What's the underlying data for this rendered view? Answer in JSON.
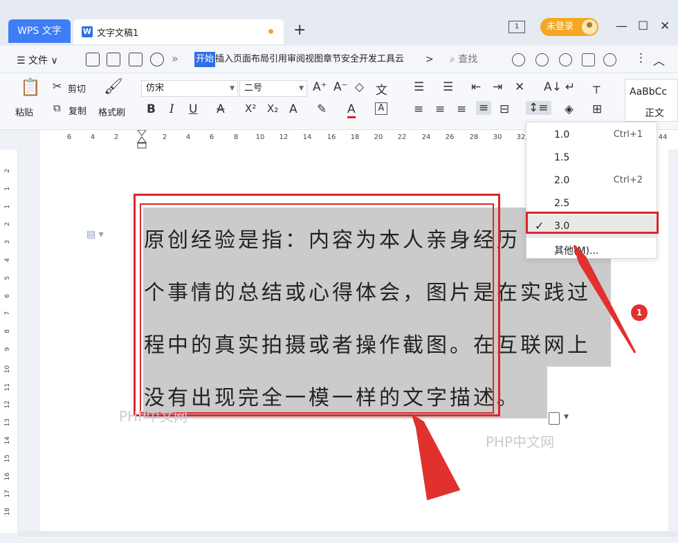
{
  "titlebar": {
    "app_tab": "WPS 文字",
    "doc_tab": "文字文稿1",
    "doc_icon": "W",
    "new_tab": "+",
    "window_icon": "1",
    "login": "未登录",
    "min": "—",
    "max": "☐",
    "close": "✕"
  },
  "menubar": {
    "file": "☰ 文件 ∨",
    "more": "»",
    "active_tab": "开始",
    "tabs": "插入页面布局引用审阅视图章节安全开发工具云",
    "tab_more": ">",
    "search": "⌕ 查找"
  },
  "ribbon": {
    "paste": "粘贴",
    "cut": "剪切",
    "copy": "复制",
    "format_painter": "格式刷",
    "font": "仿宋",
    "size": "二号",
    "style_preview": "AaBbCc",
    "style_name": "正文",
    "bold": "B",
    "italic": "I",
    "underline": "U",
    "super": "X²",
    "sub": "X₂"
  },
  "ruler": {
    "ticks": [
      "6",
      "4",
      "2",
      "2",
      "4",
      "6",
      "8",
      "10",
      "12",
      "14",
      "16",
      "18",
      "20",
      "22",
      "24",
      "26",
      "28",
      "30",
      "32",
      "44"
    ],
    "left_ticks": [
      "2",
      "1",
      "1",
      "2",
      "3",
      "4",
      "5",
      "6",
      "7",
      "8",
      "9",
      "10",
      "11",
      "12",
      "13",
      "14",
      "15",
      "16",
      "17",
      "18"
    ]
  },
  "document": {
    "lines": [
      "原创经验是指：内容为本人亲身经历",
      "个事情的总结或心得体会，图片是在实践过",
      "程中的真实拍摄或者操作截图。在互联网上",
      "没有出现完全一模一样的文字描述。"
    ],
    "watermark": "PHP中文网"
  },
  "line_spacing_menu": {
    "items": [
      {
        "label": "1.0",
        "shortcut": "Ctrl+1"
      },
      {
        "label": "1.5",
        "shortcut": ""
      },
      {
        "label": "2.0",
        "shortcut": "Ctrl+2"
      },
      {
        "label": "2.5",
        "shortcut": ""
      },
      {
        "label": "3.0",
        "shortcut": ""
      },
      {
        "label": "其他(M)...",
        "shortcut": ""
      }
    ],
    "checked": "✓",
    "selected_index": 4
  },
  "annotation": {
    "badge": "1",
    "color": "#d9262c"
  }
}
